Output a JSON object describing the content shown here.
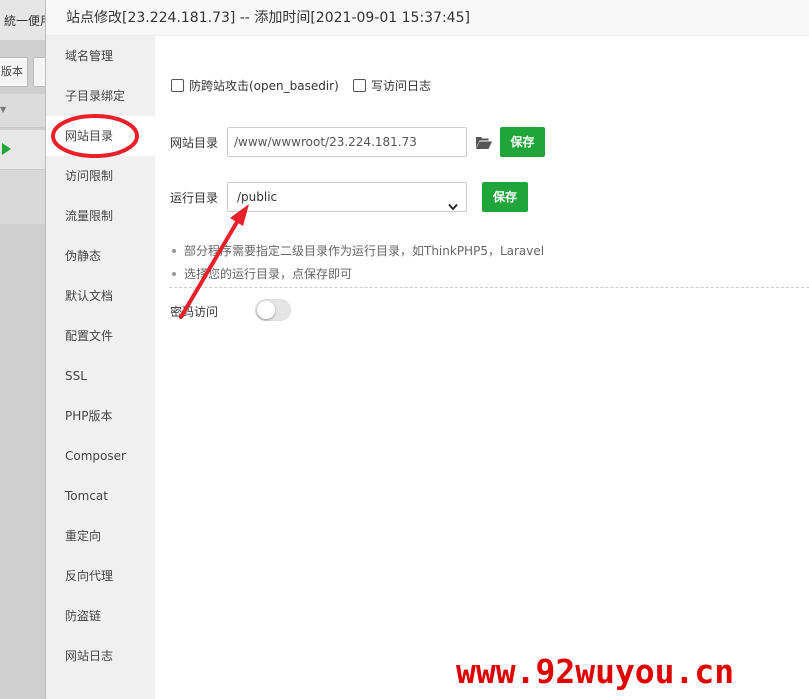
{
  "background_app": {
    "title": "統一便用",
    "button_label": "版本"
  },
  "modal": {
    "title": "站点修改[23.224.181.73] -- 添加时间[2021-09-01 15:37:45]"
  },
  "sidebar": {
    "items": [
      {
        "label": "域名管理"
      },
      {
        "label": "子目录绑定"
      },
      {
        "label": "网站目录"
      },
      {
        "label": "访问限制"
      },
      {
        "label": "流量限制"
      },
      {
        "label": "伪静态"
      },
      {
        "label": "默认文档"
      },
      {
        "label": "配置文件"
      },
      {
        "label": "SSL"
      },
      {
        "label": "PHP版本"
      },
      {
        "label": "Composer"
      },
      {
        "label": "Tomcat"
      },
      {
        "label": "重定向"
      },
      {
        "label": "反向代理"
      },
      {
        "label": "防盗链"
      },
      {
        "label": "网站日志"
      }
    ],
    "active_index": 2
  },
  "content": {
    "checkbox_open_basedir": {
      "label": "防跨站攻击(open_basedir)",
      "checked": false
    },
    "checkbox_access_log": {
      "label": "写访问日志",
      "checked": false
    },
    "site_dir": {
      "label": "网站目录",
      "value": "/www/wwwroot/23.224.181.73",
      "save_label": "保存"
    },
    "run_dir": {
      "label": "运行目录",
      "value": "/public",
      "save_label": "保存"
    },
    "tips": [
      "部分程序需要指定二级目录作为运行目录，如ThinkPHP5，Laravel",
      "选择您的运行目录，点保存即可"
    ],
    "password_access": {
      "label": "密码访问",
      "enabled": false
    }
  },
  "watermark": "www.92wuyou.cn",
  "colors": {
    "accent_green": "#20a53a",
    "sidebar_bg": "#f0f0f0",
    "annotation_red": "#e8202a",
    "watermark_red": "#e00000"
  },
  "icons": {
    "folder": "folder-open-icon",
    "select_arrow": "chevron-down-icon",
    "run_icon": "play-icon"
  }
}
